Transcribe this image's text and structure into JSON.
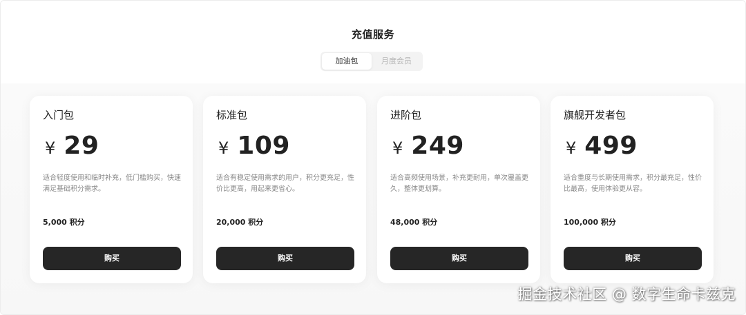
{
  "page": {
    "title": "充值服务"
  },
  "tabs": [
    {
      "label": "加油包",
      "active": true
    },
    {
      "label": "月度会员",
      "active": false
    }
  ],
  "plans": [
    {
      "name": "入门包",
      "currency": "¥",
      "price": "29",
      "description": "适合轻度使用和临时补充，低门槛购买，快速满足基础积分需求。",
      "points": "5,000 积分",
      "button_label": "购买"
    },
    {
      "name": "标准包",
      "currency": "¥",
      "price": "109",
      "description": "适合有稳定使用需求的用户，积分更充足，性价比更高，用起来更省心。",
      "points": "20,000 积分",
      "button_label": "购买"
    },
    {
      "name": "进阶包",
      "currency": "¥",
      "price": "249",
      "description": "适合高频使用场景，补充更耐用，单次覆盖更久，整体更划算。",
      "points": "48,000 积分",
      "button_label": "购买"
    },
    {
      "name": "旗舰开发者包",
      "currency": "¥",
      "price": "499",
      "description": "适合重度与长期使用需求，积分最充足，性价比最高，使用体验更从容。",
      "points": "100,000 积分",
      "button_label": "购买"
    }
  ],
  "watermark": "掘金技术社区 @ 数字生命卡兹克",
  "colors": {
    "button_bg": "#262626",
    "button_text": "#ffffff",
    "muted_text": "#888888",
    "inactive_tab_text": "#b5b5b5"
  }
}
